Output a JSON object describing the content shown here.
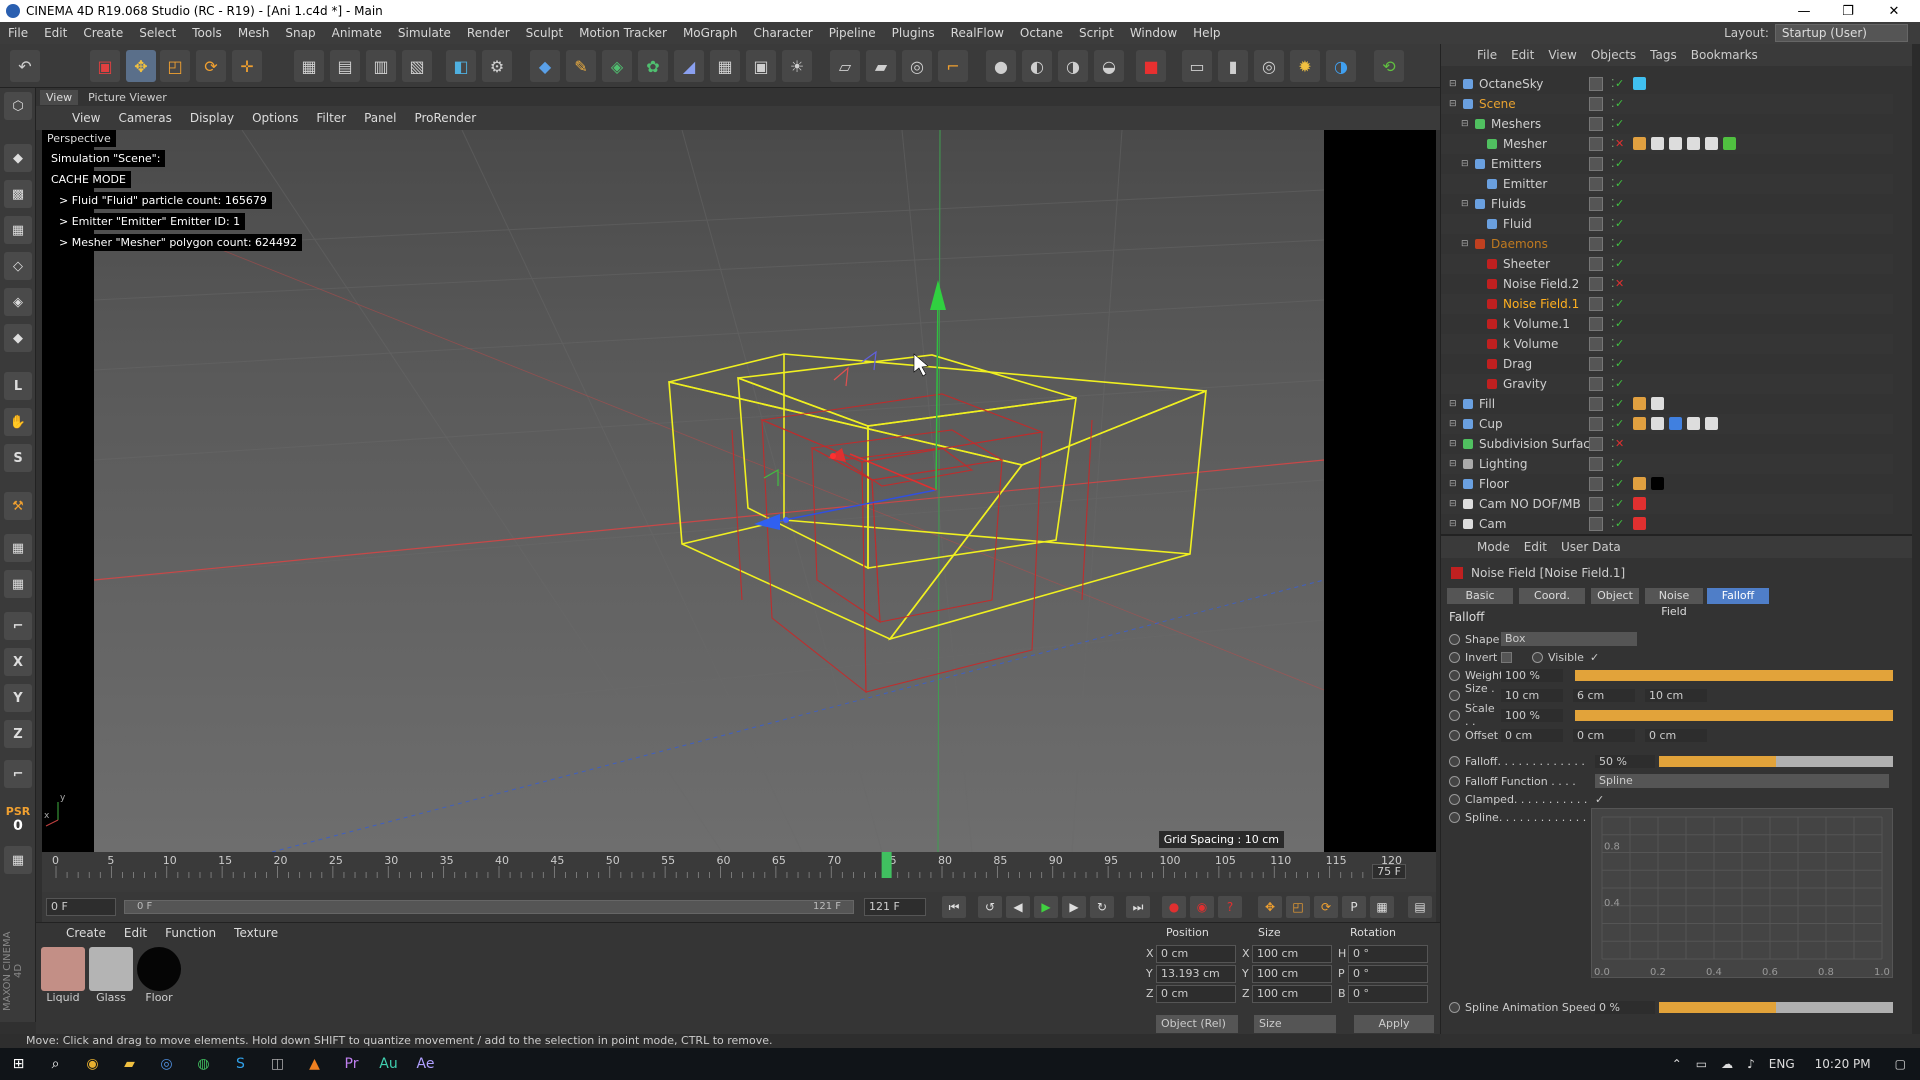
{
  "window": {
    "title": "CINEMA 4D R19.068 Studio (RC - R19) - [Ani 1.c4d *] - Main"
  },
  "menu": [
    "File",
    "Edit",
    "Create",
    "Select",
    "Tools",
    "Mesh",
    "Snap",
    "Animate",
    "Simulate",
    "Render",
    "Sculpt",
    "Motion Tracker",
    "MoGraph",
    "Character",
    "Pipeline",
    "Plugins",
    "RealFlow",
    "Octane",
    "Script",
    "Window",
    "Help"
  ],
  "layout": {
    "label": "Layout:",
    "value": "Startup (User)"
  },
  "view_tabs": [
    "View",
    "Picture Viewer"
  ],
  "view_menu": [
    "View",
    "Cameras",
    "Display",
    "Options",
    "Filter",
    "Panel",
    "ProRender"
  ],
  "viewport": {
    "name": "Perspective",
    "hud": [
      "Simulation \"Scene\":",
      "CACHE MODE",
      "> Fluid \"Fluid\" particle count: 165679",
      "> Emitter \"Emitter\" Emitter ID: 1",
      "> Mesher \"Mesher\" polygon count: 624492"
    ],
    "grid_spacing": "Grid Spacing : 10 cm"
  },
  "left_tools": {
    "psr": "PSR",
    "psr_value": "0"
  },
  "timeline": {
    "ticks": [
      "0",
      "5",
      "10",
      "15",
      "20",
      "25",
      "30",
      "35",
      "40",
      "45",
      "50",
      "55",
      "60",
      "65",
      "70",
      "75",
      "80",
      "85",
      "90",
      "95",
      "100",
      "105",
      "110",
      "115",
      "120"
    ],
    "current_frame": "75 F",
    "start_field": "0 F",
    "range_start": "0 F",
    "range_end": "121 F",
    "end_field": "121 F"
  },
  "material_panel": {
    "menu": [
      "Create",
      "Edit",
      "Function",
      "Texture"
    ],
    "materials": [
      {
        "label": "Liquid",
        "color": "#c38f86"
      },
      {
        "label": "Glass",
        "color": "#b4b4b4"
      },
      {
        "label": "Floor",
        "color": "#050505"
      }
    ]
  },
  "coord_panel": {
    "headers": [
      "Position",
      "Size",
      "Rotation"
    ],
    "rows": [
      {
        "axis": "X",
        "pos": "0 cm",
        "size_axis": "X",
        "size": "100 cm",
        "rot_axis": "H",
        "rot": "0 °"
      },
      {
        "axis": "Y",
        "pos": "13.193 cm",
        "size_axis": "Y",
        "size": "100 cm",
        "rot_axis": "P",
        "rot": "0 °"
      },
      {
        "axis": "Z",
        "pos": "0 cm",
        "size_axis": "Z",
        "size": "100 cm",
        "rot_axis": "B",
        "rot": "0 °"
      }
    ],
    "mode": "Object (Rel)",
    "size_mode": "Size",
    "apply": "Apply"
  },
  "status_bar": "Move: Click and drag to move elements. Hold down SHIFT to quantize movement / add to the selection in point mode, CTRL to remove.",
  "object_manager": {
    "menu": [
      "File",
      "Edit",
      "View",
      "Objects",
      "Tags",
      "Bookmarks"
    ],
    "objects": [
      {
        "name": "OctaneSky",
        "indent": 0,
        "color": "#cfcfcf"
      },
      {
        "name": "Scene",
        "indent": 0,
        "color": "#e8a230"
      },
      {
        "name": "Meshers",
        "indent": 1,
        "color": "#cfcfcf"
      },
      {
        "name": "Mesher",
        "indent": 2,
        "color": "#cfcfcf"
      },
      {
        "name": "Emitters",
        "indent": 1,
        "color": "#cfcfcf"
      },
      {
        "name": "Emitter",
        "indent": 2,
        "color": "#cfcfcf"
      },
      {
        "name": "Fluids",
        "indent": 1,
        "color": "#cfcfcf"
      },
      {
        "name": "Fluid",
        "indent": 2,
        "color": "#cfcfcf"
      },
      {
        "name": "Daemons",
        "indent": 1,
        "color": "#c07a20"
      },
      {
        "name": "Sheeter",
        "indent": 2,
        "color": "#cfcfcf"
      },
      {
        "name": "Noise Field.2",
        "indent": 2,
        "color": "#cfcfcf"
      },
      {
        "name": "Noise Field.1",
        "indent": 2,
        "color": "#ffb020"
      },
      {
        "name": "k Volume.1",
        "indent": 2,
        "color": "#cfcfcf"
      },
      {
        "name": "k Volume",
        "indent": 2,
        "color": "#cfcfcf"
      },
      {
        "name": "Drag",
        "indent": 2,
        "color": "#cfcfcf"
      },
      {
        "name": "Gravity",
        "indent": 2,
        "color": "#cfcfcf"
      },
      {
        "name": "Fill",
        "indent": 0,
        "color": "#cfcfcf"
      },
      {
        "name": "Cup",
        "indent": 0,
        "color": "#cfcfcf"
      },
      {
        "name": "Subdivision Surface",
        "indent": 0,
        "color": "#cfcfcf"
      },
      {
        "name": "Lighting",
        "indent": 0,
        "color": "#cfcfcf"
      },
      {
        "name": "Floor",
        "indent": 0,
        "color": "#cfcfcf"
      },
      {
        "name": "Cam NO DOF/MB",
        "indent": 0,
        "color": "#cfcfcf"
      },
      {
        "name": "Cam",
        "indent": 0,
        "color": "#cfcfcf"
      }
    ]
  },
  "attribute_manager": {
    "menu": [
      "Mode",
      "Edit",
      "User Data"
    ],
    "object_title": "Noise Field [Noise Field.1]",
    "tabs": [
      "Basic",
      "Coord.",
      "Object",
      "Noise Field",
      "Falloff"
    ],
    "active_tab": "Falloff",
    "section": "Falloff",
    "shape_label": "Shape",
    "shape_value": "Box",
    "invert_label": "Invert",
    "visible_label": "Visible",
    "visible_check": "✓",
    "weight_label": "Weight",
    "weight_value": "100 %",
    "weight_fraction": 1.0,
    "size_label": "Size . . .",
    "size_values": [
      "10 cm",
      "6 cm",
      "10 cm"
    ],
    "scale_label": "Scale . .",
    "scale_value": "100 %",
    "scale_fraction": 1.0,
    "offset_label": "Offset",
    "offset_values": [
      "0 cm",
      "0 cm",
      "0 cm"
    ],
    "falloff_label": "Falloff. . . . . . . . . . . . .",
    "falloff_value": "50 %",
    "falloff_fraction": 0.5,
    "falloff_function_label": "Falloff Function . . . .",
    "falloff_function_value": "Spline",
    "clamped_label": "Clamped. . . . . . . . . . .",
    "clamped_check": "✓",
    "spline_label": "Spline. . . . . . . . . . . . .",
    "spline_y_ticks": [
      "0.8",
      "0.4"
    ],
    "spline_x_ticks": [
      "0.0",
      "0.2",
      "0.4",
      "0.6",
      "0.8",
      "1.0"
    ],
    "spline_anim_label": "Spline Animation Speed",
    "spline_anim_value": "0 %",
    "spline_anim_fraction": 0.5
  },
  "taskbar": {
    "lang": "ENG",
    "time": "10:20 PM"
  }
}
